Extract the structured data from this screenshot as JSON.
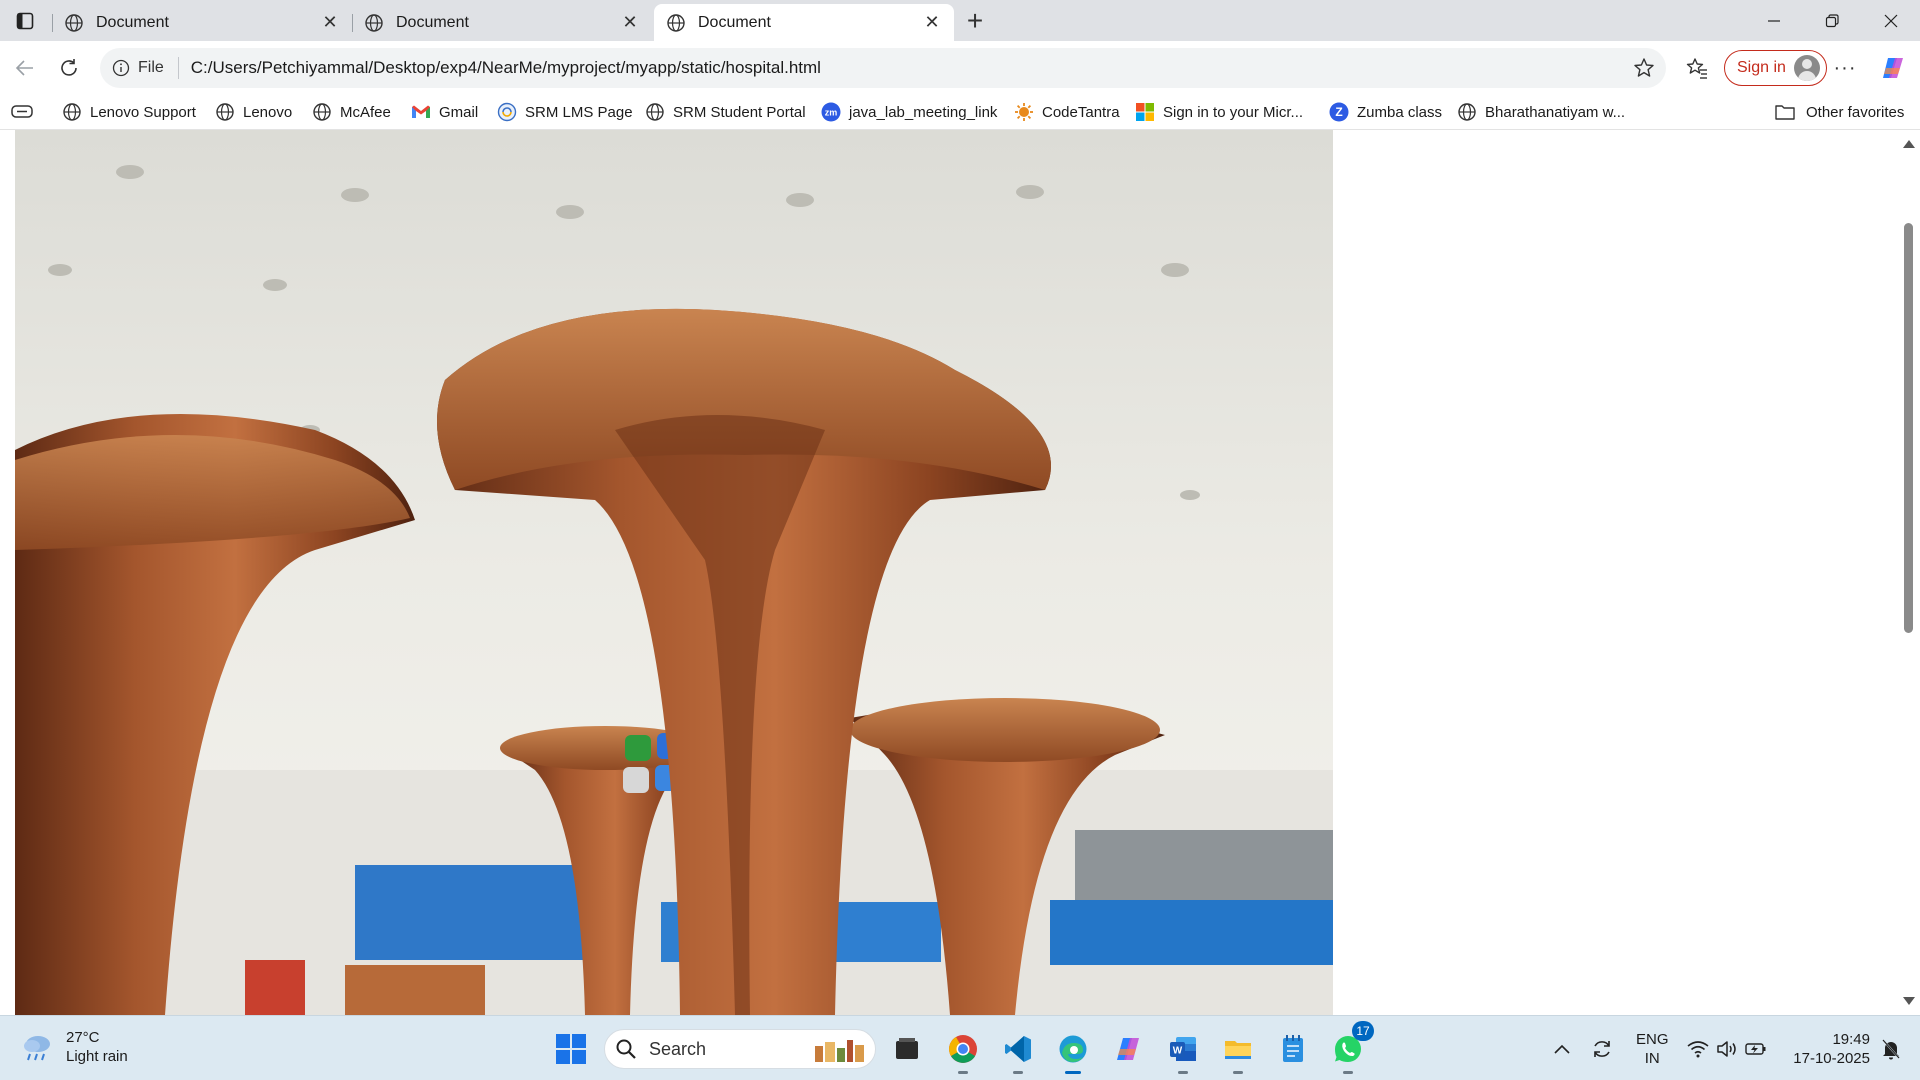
{
  "tabs": [
    {
      "title": "Document",
      "active": false
    },
    {
      "title": "Document",
      "active": false
    },
    {
      "title": "Document",
      "active": true
    }
  ],
  "address": {
    "scheme_label": "File",
    "url": "C:/Users/Petchiyammal/Desktop/exp4/NearMe/myproject/myapp/static/hospital.html"
  },
  "toolbar": {
    "signin_label": "Sign in"
  },
  "bookmarks": [
    {
      "label": "Lenovo Support",
      "icon": "globe-icon"
    },
    {
      "label": "Lenovo",
      "icon": "globe-icon"
    },
    {
      "label": "McAfee",
      "icon": "globe-icon"
    },
    {
      "label": "Gmail",
      "icon": "gmail-icon"
    },
    {
      "label": "SRM LMS Page",
      "icon": "srm-lms-icon"
    },
    {
      "label": "SRM Student Portal",
      "icon": "globe-icon"
    },
    {
      "label": "java_lab_meeting_link",
      "icon": "zoom-icon"
    },
    {
      "label": "CodeTantra",
      "icon": "codetantra-icon"
    },
    {
      "label": "Sign in to your Micr...",
      "icon": "microsoft-icon"
    },
    {
      "label": "Zumba class",
      "icon": "zoom-icon"
    },
    {
      "label": "Bharathanatiyam w...",
      "icon": "globe-icon"
    }
  ],
  "other_favorites": "Other favorites",
  "content": {
    "image_kind": "hospital lobby photo with wooden tree-shaped pillars"
  },
  "taskbar": {
    "weather_temp": "27°C",
    "weather_desc": "Light rain",
    "search_label": "Search",
    "whatsapp_badge": "17",
    "lang_top": "ENG",
    "lang_bottom": "IN",
    "time": "19:49",
    "date": "17-10-2025",
    "apps": [
      "file-manager-icon",
      "chrome-icon",
      "vscode-icon",
      "edge-icon",
      "copilot-icon",
      "word-icon",
      "file-explorer-icon",
      "notepad-icon",
      "whatsapp-icon"
    ]
  },
  "colors": {
    "accent": "#0067c0",
    "signin_red": "#c42b1c",
    "tabstrip": "#dfe1e5",
    "taskbar": "#dce9f2"
  }
}
